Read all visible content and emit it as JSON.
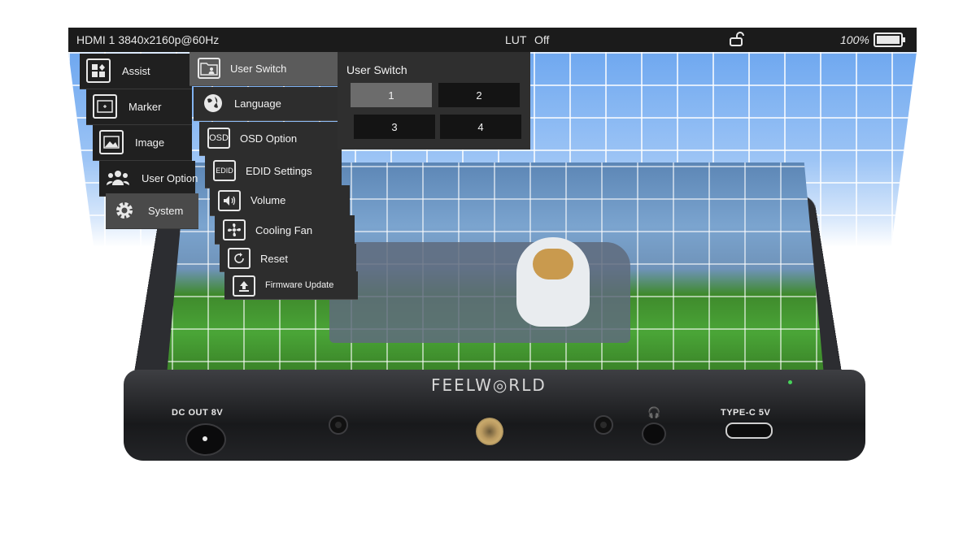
{
  "status": {
    "input": "HDMI 1  3840x2160p@60Hz",
    "lut_label": "LUT",
    "lut_value": "Off",
    "battery": "100%"
  },
  "menu_l1": [
    {
      "label": "Assist",
      "icon": "assist-icon"
    },
    {
      "label": "Marker",
      "icon": "marker-icon"
    },
    {
      "label": "Image",
      "icon": "image-icon"
    },
    {
      "label": "User Option",
      "icon": "users-icon"
    },
    {
      "label": "System",
      "icon": "gear-icon",
      "active": true
    }
  ],
  "menu_l2": [
    {
      "label": "User Switch",
      "icon": "folder-user-icon",
      "active": true
    },
    {
      "label": "Language",
      "icon": "globe-icon",
      "icon_text": ""
    },
    {
      "label": "OSD Option",
      "icon": "osd-icon",
      "icon_text": "OSD"
    },
    {
      "label": "EDID Settings",
      "icon": "edid-icon",
      "icon_text": "EDID"
    },
    {
      "label": "Volume",
      "icon": "speaker-icon"
    },
    {
      "label": "Cooling Fan",
      "icon": "fan-icon"
    },
    {
      "label": "Reset",
      "icon": "reset-icon"
    },
    {
      "label": "Firmware Update",
      "icon": "upload-icon"
    }
  ],
  "panel": {
    "title": "User Switch",
    "buttons": [
      "1",
      "2",
      "3",
      "4"
    ],
    "selected": "1"
  },
  "device": {
    "brand": "FEELW◎RLD",
    "dc_out": "DC OUT 8V",
    "type_c": "TYPE-C 5V"
  }
}
